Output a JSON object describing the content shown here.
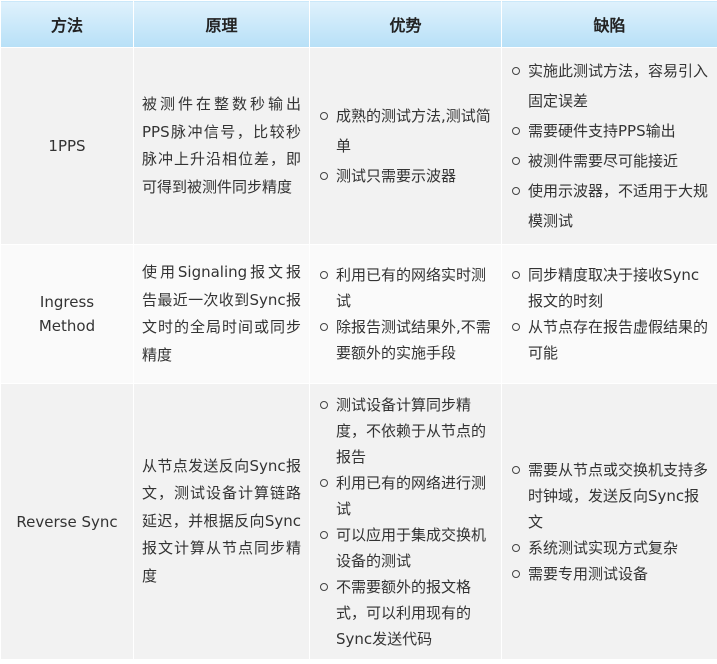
{
  "headers": [
    "方法",
    "原理",
    "优势",
    "缺陷"
  ],
  "rows": [
    {
      "method": "1PPS",
      "principle": "被测件在整数秒输出PPS脉冲信号，比较秒脉冲上升沿相位差，即可得到被测件同步精度",
      "advantages": [
        "成熟的测试方法,测试简单",
        "测试只需要示波器"
      ],
      "disadvantages": [
        "实施此测试方法，容易引入固定误差",
        "需要硬件支持PPS输出",
        "被测件需要尽可能接近",
        "使用示波器，不适用于大规模测试"
      ]
    },
    {
      "method": "Ingress Method",
      "principle": "使用Signaling报文报告最近一次收到Sync报文时的全局时间或同步精度",
      "advantages": [
        "利用已有的网络实时测试",
        "除报告测试结果外,不需要额外的实施手段"
      ],
      "disadvantages": [
        "同步精度取决于接收Sync报文的时刻",
        "从节点存在报告虚假结果的可能"
      ]
    },
    {
      "method": "Reverse Sync",
      "principle": "从节点发送反向Sync报文，测试设备计算链路延迟，并根据反向Sync报文计算从节点同步精度",
      "advantages": [
        "测试设备计算同步精度，不依赖于从节点的报告",
        "利用已有的网络进行测试",
        "可以应用于集成交换机设备的测试",
        "不需要额外的报文格式，可以利用现有的Sync发送代码"
      ],
      "disadvantages": [
        "需要从节点或交换机支持多时钟域，发送反向Sync报文",
        "系统测试实现方式复杂",
        "需要专用测试设备"
      ]
    }
  ]
}
